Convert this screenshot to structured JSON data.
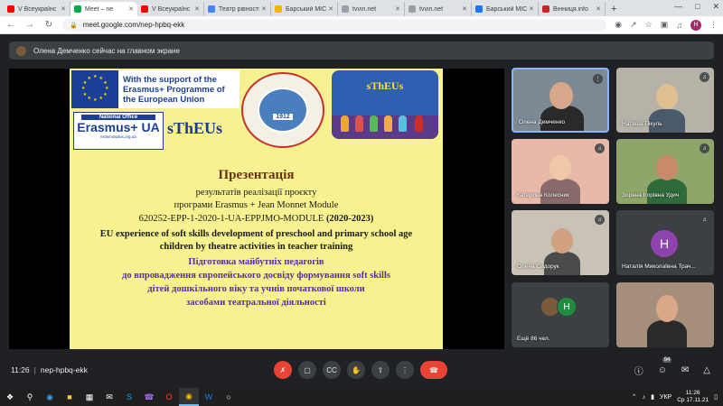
{
  "browser": {
    "tabs": [
      {
        "label": "V Всеукраїнс",
        "color": "#ff0000"
      },
      {
        "label": "Meet – ne",
        "color": "#00ac47",
        "active": true
      },
      {
        "label": "V Всеукраїнс",
        "color": "#ff0000"
      },
      {
        "label": "Театр рівності",
        "color": "#4285f4"
      },
      {
        "label": "Барський МІС",
        "color": "#f4b400"
      },
      {
        "label": "tvvin.net",
        "color": "#9aa0a6"
      },
      {
        "label": "tvvin.net",
        "color": "#9aa0a6"
      },
      {
        "label": "Барський МІС",
        "color": "#1877f2"
      },
      {
        "label": "Вінниця.info",
        "color": "#c62828"
      }
    ],
    "new_tab": "+",
    "url": "meet.google.com/nep-hpbq-ekk",
    "profile_initial": "H"
  },
  "meet": {
    "presenter_banner": "Олена Демченко сейчас на главном экране",
    "meeting_time": "11:26",
    "meeting_code": "nep-hpbq-ekk",
    "participant_count": "94",
    "participants": [
      {
        "name": "Олена Демченко",
        "speaking": true
      },
      {
        "name": "Наташа Пікуль"
      },
      {
        "name": "Катерина Колесник"
      },
      {
        "name": "Зоряна Ігорівна Удич"
      },
      {
        "name": "Олена Сидорук"
      },
      {
        "name": "Наталія Миколаївна Трач...",
        "initial": "H"
      },
      {
        "name": "Ещё 86 чел.",
        "initial": "H"
      },
      {
        "name": ""
      }
    ]
  },
  "slide": {
    "eu_support": "With the support of the Erasmus+ Programme of the European Union",
    "national_office": "National Office",
    "erasmus_ua": "Erasmus+ UA",
    "erasmus_url": "erasmusplus.org.ua",
    "stheus_side": "sThEUs",
    "seal_year": "1912",
    "logo_title": "sThEUs",
    "title": "Презентація",
    "line1": "результатів реалізації  проєкту",
    "line2": "програми Erasmus + Jean Monnet Module",
    "line3_code": "620252-EPP-1-2020-1-UA-EPPJMO-MODULE",
    "line3_years": "(2020-2023)",
    "line4": "EU experience of soft skills development of preschool and primary school age children by theatre activities in teacher training",
    "ua1": "Підготовка майбутніх педагогів",
    "ua2": "до впровадження європейського досвіду формування soft skills",
    "ua3": "дітей дошкільного віку та учнів початкової школи",
    "ua4": "засобами театральної діяльності"
  },
  "taskbar": {
    "lang": "УКР",
    "time": "11:26",
    "date": "Ср 17.11.21"
  }
}
